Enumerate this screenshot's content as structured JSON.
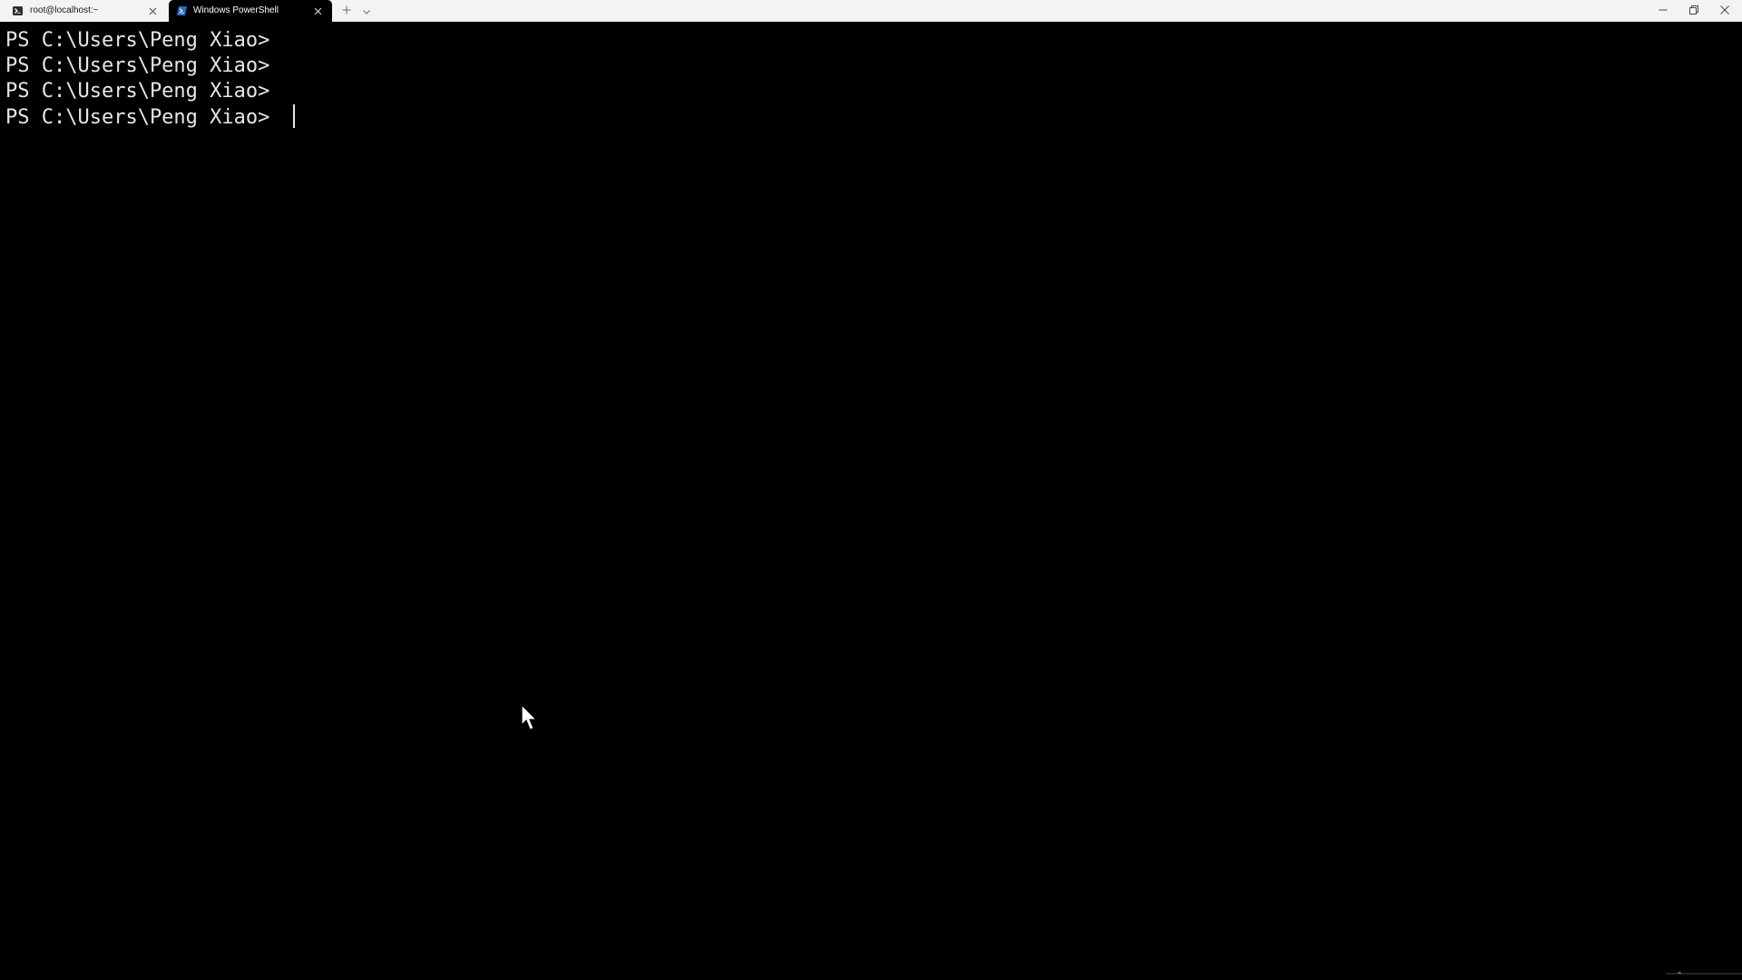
{
  "tabs": [
    {
      "label": "root@localhost:~",
      "icon": "ssh-terminal-icon",
      "active": false
    },
    {
      "label": "Windows PowerShell",
      "icon": "powershell-icon",
      "active": true
    }
  ],
  "terminal": {
    "lines": [
      "PS C:\\Users\\Peng Xiao>",
      "PS C:\\Users\\Peng Xiao>",
      "PS C:\\Users\\Peng Xiao>",
      "PS C:\\Users\\Peng Xiao> "
    ]
  },
  "colors": {
    "background": "#000000",
    "foreground": "#e6e6e6",
    "tab_bar": "#f3f3f3",
    "powershell_icon": "#2b6cc4"
  }
}
